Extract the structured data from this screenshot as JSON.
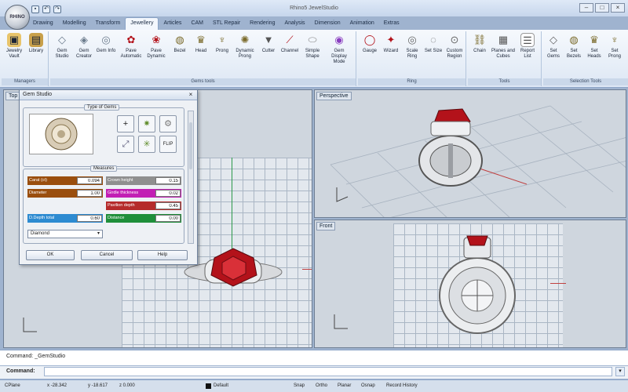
{
  "app": {
    "title": "Rhino5 JewelStudio",
    "logo_text": "RHINO"
  },
  "tabs": [
    "Drawing",
    "Modelling",
    "Transform",
    "Jewellery",
    "Articles",
    "CAM",
    "STL Repair",
    "Rendering",
    "Analysis",
    "Dimension",
    "Animation",
    "Extras"
  ],
  "active_tab": "Jewellery",
  "ribbon": {
    "groups": {
      "managers": "Managers",
      "gems": "Gems tools",
      "ring": "Ring",
      "tools": "Tools",
      "selection": "Selection Tools"
    },
    "buttons": {
      "jewelry_vault": "Jewelry Vault",
      "library": "Library",
      "gem_studio": "Gem Studio",
      "gem_creator": "Gem Creator",
      "gem_info": "Gem Info",
      "pave_automatic": "Pave Automatic",
      "pave_dynamic": "Pave Dynamic",
      "bezel": "Bezel",
      "head": "Head",
      "prong": "Prong",
      "dynamic_prong": "Dynamic Prong",
      "cutter": "Cutter",
      "channel": "Channel",
      "simple_shape": "Simple Shape",
      "gem_display_mode": "Gem Display Mode",
      "gauge": "Gauge",
      "wizard": "Wizard",
      "scale_ring": "Scale Ring",
      "set_size": "Set Size",
      "custom_region": "Custom Region",
      "chain": "Chain",
      "planes_cubes": "Planes and Cubes",
      "report_list": "Report List",
      "set_gems": "Set Gems",
      "set_bezels": "Set Bezels",
      "set_heads": "Set Heads",
      "set_prongs": "Set Prong"
    }
  },
  "viewports": {
    "top": "Top",
    "perspective": "Perspective",
    "front": "Front"
  },
  "dialog": {
    "title": "Gem Studio",
    "type_section": "Type of Gems",
    "measures_section": "Measures",
    "fields": {
      "carat": {
        "label": "Carat (ct)",
        "value": "0.094"
      },
      "diameter": {
        "label": "Diameter",
        "value": "1.00"
      },
      "crown_height": {
        "label": "Crown height",
        "value": "0.15"
      },
      "girdle": {
        "label": "Girdle thickness",
        "value": "0.02"
      },
      "pavilion": {
        "label": "Pavilion depth",
        "value": "0.45"
      },
      "depth": {
        "label": "D.Depth total",
        "value": "0.60"
      },
      "distance": {
        "label": "Distance",
        "value": "0.00"
      }
    },
    "material": "Diamond",
    "flip_label": "FLIP",
    "ok": "OK",
    "cancel": "Cancel",
    "help": "Help"
  },
  "command": {
    "history": "Command: _GemStudio",
    "label": "Command:",
    "value": ""
  },
  "status": {
    "cplane": "CPlane",
    "x": "x -28.342",
    "y": "y -18.617",
    "z": "z 0.000",
    "layer": "Default",
    "snap": "Snap",
    "ortho": "Ortho",
    "planar": "Planar",
    "osnap": "Osnap",
    "record": "Record History"
  },
  "colors": {
    "carat": "#9a4e0e",
    "diameter": "#9a4e0e",
    "crown": "#8f8f8f",
    "girdle": "#c21fb4",
    "pavilion": "#b52b2b",
    "depth": "#2d8bd1",
    "distance": "#1f8f3a",
    "gem": "#b3121a"
  }
}
